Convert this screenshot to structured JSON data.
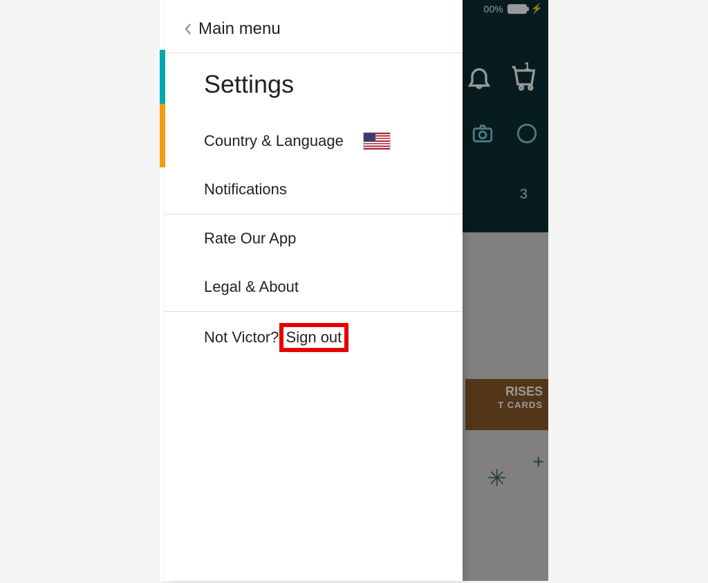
{
  "status": {
    "battery_percent": "00%",
    "charging_glyph": "⚡"
  },
  "drawer": {
    "back_label": "Main menu",
    "title": "Settings",
    "items": {
      "country_language": "Country & Language",
      "notifications": "Notifications",
      "rate_app": "Rate Our App",
      "legal_about": "Legal & About"
    },
    "signout_prefix": "Not Victor? ",
    "signout_link": "Sign out"
  },
  "background": {
    "cart_count": "1",
    "banner_line1": "RISES",
    "banner_line2": "T CARDS",
    "banner_partial_text": "3"
  }
}
